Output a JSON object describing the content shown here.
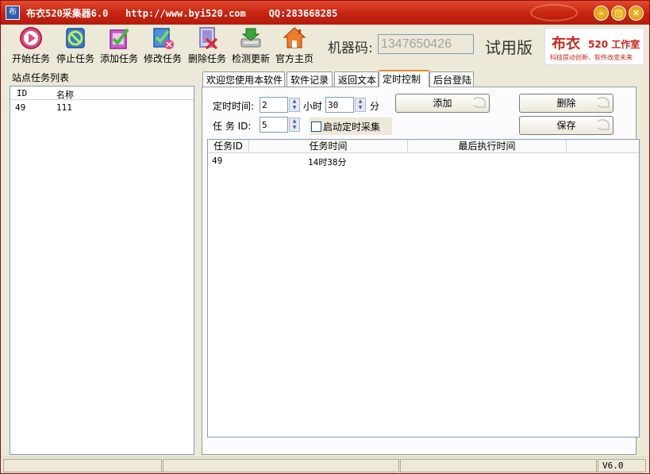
{
  "window": {
    "title": "布衣520采集器6.0   http://www.byi520.com    QQ:283668285",
    "icon_char": "布",
    "min_glyph": "–",
    "max_glyph": "□",
    "close_glyph": "✕"
  },
  "toolbar": {
    "items": [
      {
        "label": "开始任务",
        "icon": "play-icon"
      },
      {
        "label": "停止任务",
        "icon": "stop-icon"
      },
      {
        "label": "添加任务",
        "icon": "add-task-icon"
      },
      {
        "label": "修改任务",
        "icon": "edit-task-icon"
      },
      {
        "label": "删除任务",
        "icon": "delete-task-icon"
      },
      {
        "label": "检测更新",
        "icon": "update-icon"
      },
      {
        "label": "官方主页",
        "icon": "home-icon"
      }
    ],
    "machine_code_label": "机器码:",
    "machine_code_value": "1347650426",
    "trial_label": "试用版",
    "logo": {
      "main": "布衣",
      "sub": "520 工作室",
      "tagline": "科技提动创新，软件改变未来"
    }
  },
  "left": {
    "title": "站点任务列表",
    "columns": [
      "ID",
      "名称"
    ],
    "rows": [
      {
        "id": "49",
        "name": "111"
      }
    ]
  },
  "tabs": [
    "欢迎您使用本软件",
    "软件记录",
    "返回文本",
    "定时控制",
    "后台登陆"
  ],
  "schedule": {
    "time_label": "定时时间:",
    "hour_value": "2",
    "hour_unit": "小时",
    "minute_value": "30",
    "minute_unit": "分",
    "task_id_label": "任 务 ID:",
    "task_id_value": "5",
    "enable_label": "启动定时采集",
    "add_button": "添加",
    "delete_button": "删除",
    "save_button": "保存"
  },
  "grid": {
    "columns": [
      "任务ID",
      "任务时间",
      "最后执行时间"
    ],
    "rows": [
      {
        "task_id": "49",
        "task_time": "14时38分",
        "last_run": ""
      }
    ]
  },
  "status": {
    "version": "V6.0"
  },
  "colors": {
    "title_bar": "#c4230f",
    "accent_tab": "#e68b2c",
    "logo_red": "#c8261a"
  }
}
